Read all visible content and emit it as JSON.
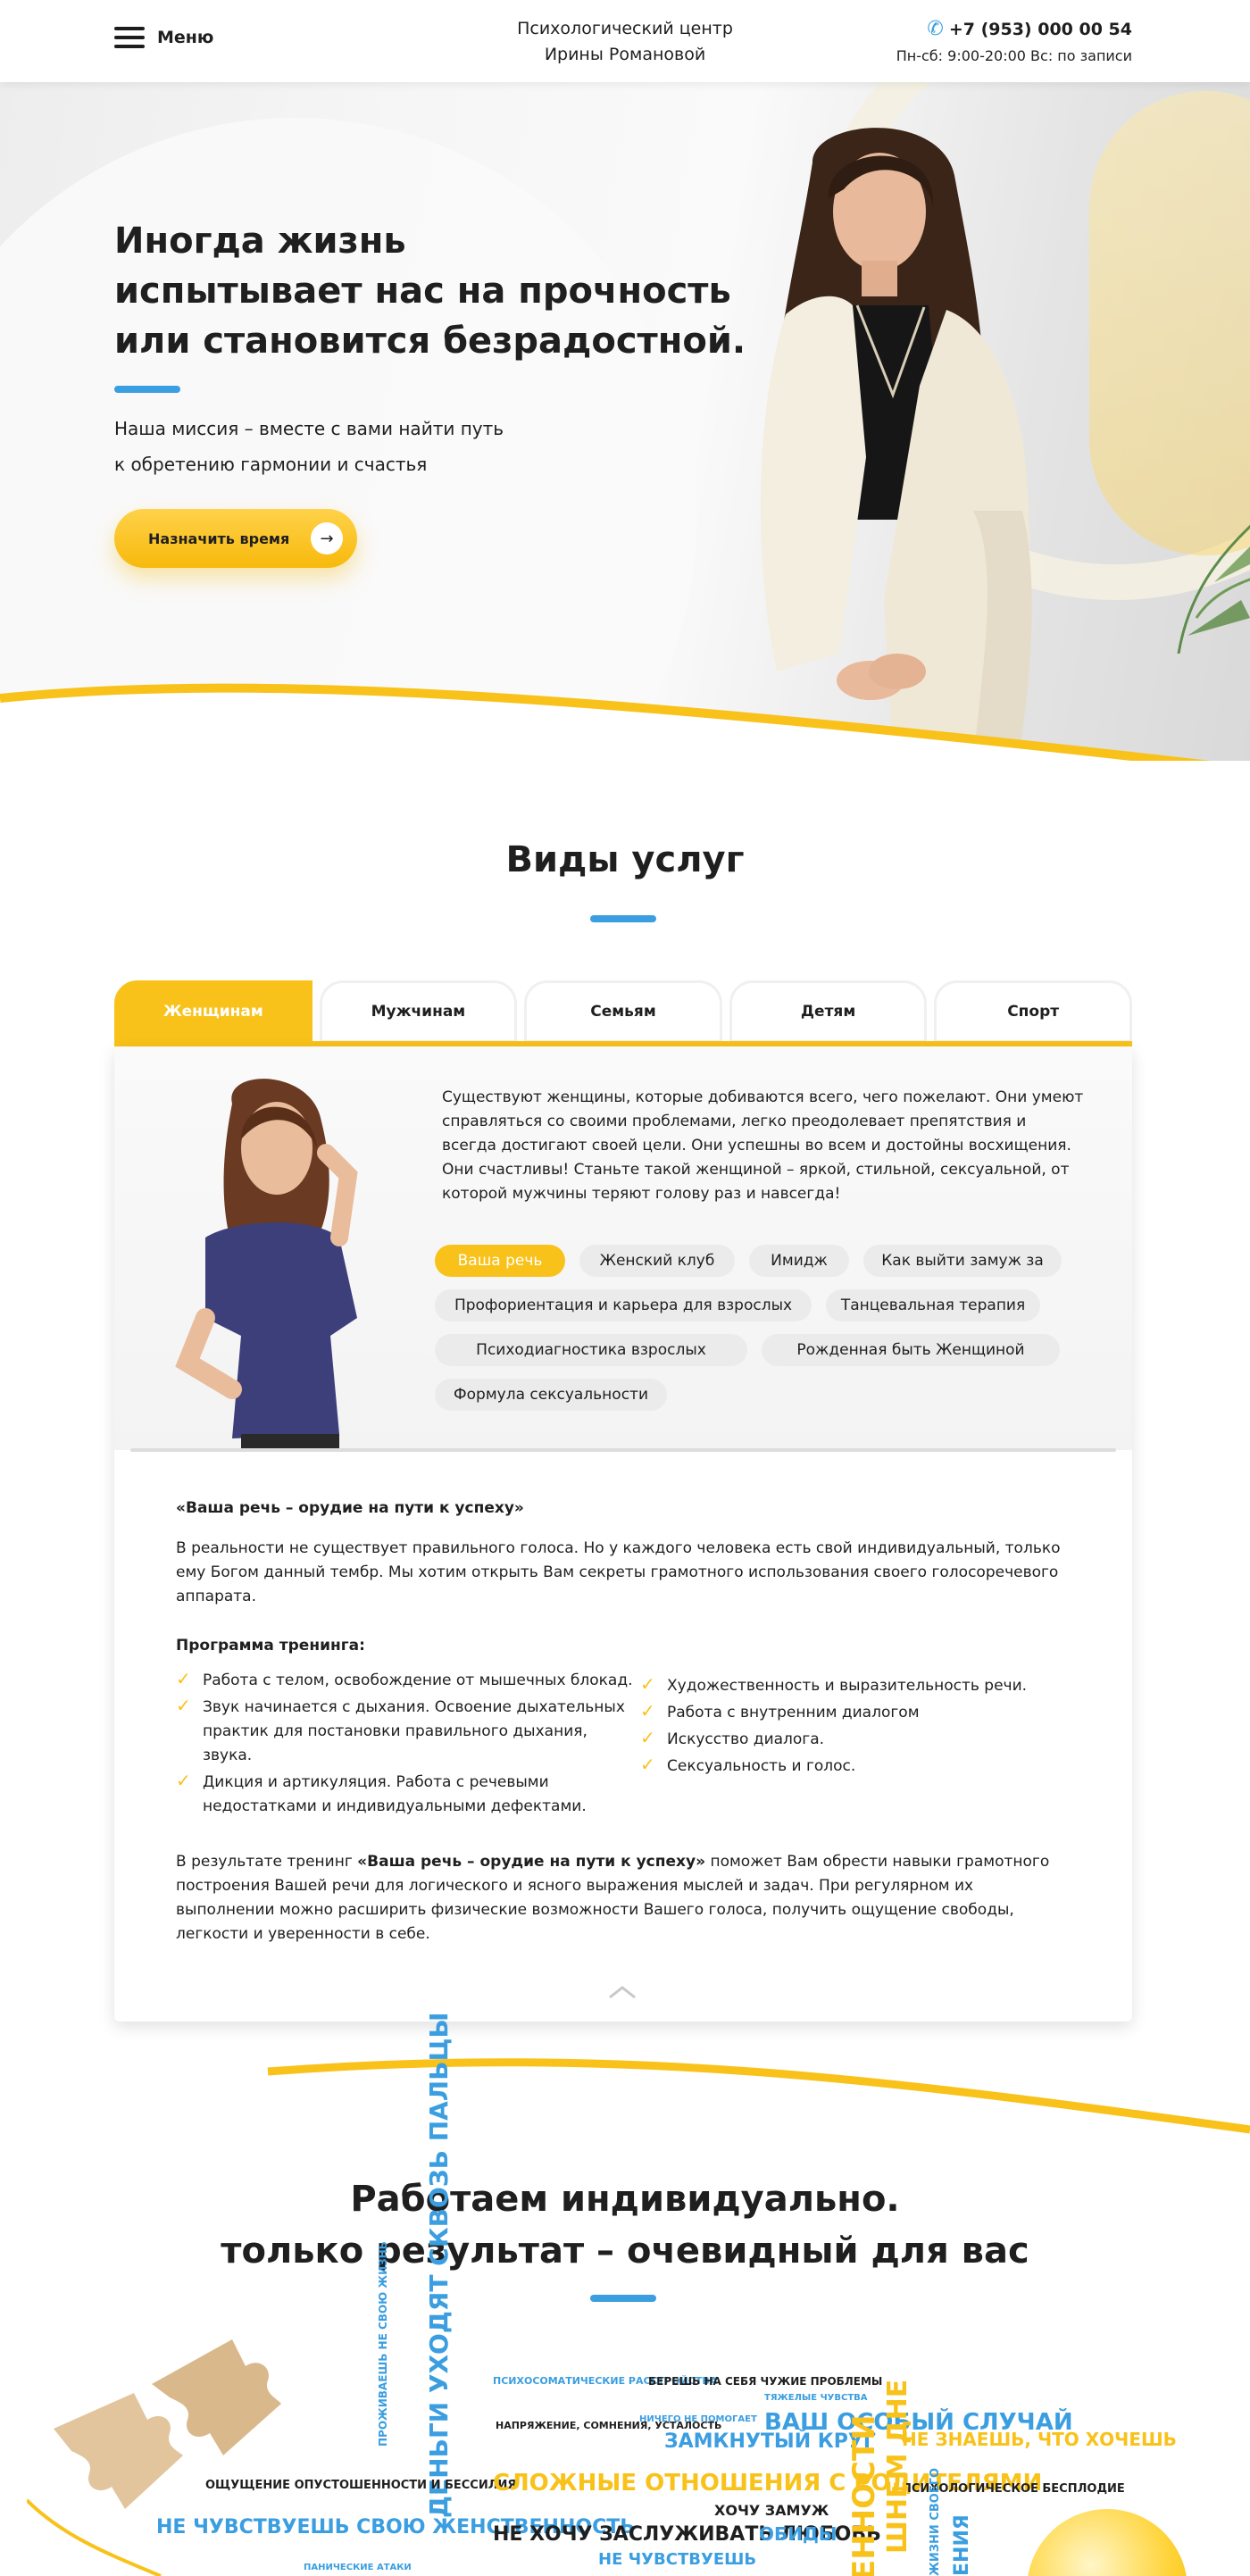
{
  "header": {
    "menu_label": "Меню",
    "brand_line1": "Психологический центр",
    "brand_line2": "Ирины Романовой",
    "phone": "+7 (953) 000 00 54",
    "hours": "Пн-сб: 9:00-20:00 Вс: по записи"
  },
  "hero": {
    "title_line1": "Иногда жизнь",
    "title_line2": "испытывает нас на прочность",
    "title_line3": "или становится безрадостной.",
    "subtitle_line1": "Наша миссия – вместе с вами найти путь",
    "subtitle_line2": "к обретению гармонии и счастья",
    "cta_label": "Назначить время"
  },
  "services": {
    "title": "Виды услуг",
    "tabs": [
      "Женщинам",
      "Мужчинам",
      "Семьям",
      "Детям",
      "Спорт"
    ],
    "active_tab": 0,
    "intro": "Существуют женщины, которые добиваются всего, чего пожелают. Они умеют справляться со своими проблемами, легко преодолевает препятствия и всегда достигают своей цели. Они успешны во всем и достойны восхищения. Они счастливы! Станьте такой женщиной – яркой, стильной, сексуальной, от которой мужчины теряют голову раз и навсегда!",
    "chips": [
      [
        "Ваша речь",
        "Женский клуб",
        "Имидж",
        "Как выйти замуж за"
      ],
      [
        "Профориентация и карьера для взрослых",
        "Танцевальная терапия"
      ],
      [
        "Психодиагностика взрослых",
        "Рожденная быть Женщиной"
      ],
      [
        "Формула сексуальности"
      ]
    ],
    "detail": {
      "heading": "«Ваша речь – орудие на пути к успеху»",
      "paragraph": "В реальности не существует правильного голоса. Но у каждого человека есть свой индивидуальный, только ему Богом данный тембр. Мы хотим открыть Вам секреты грамотного использования своего голосоречевого аппарата.",
      "program_heading": "Программа тренинга:",
      "list_left": [
        "Работа с телом, освобождение от мышечных блокад.",
        "Звук начинается с дыхания. Освоение дыхательных практик для постановки правильного дыхания, звука.",
        "Дикция и артикуляция. Работа с речевыми недостатками и индивидуальными дефектами."
      ],
      "list_right": [
        "Художественность и выразительность речи.",
        "Работа с внутренним диалогом",
        "Искусство диалога.",
        "Сексуальность и голос."
      ],
      "result_prefix": "В результате тренинг ",
      "result_bold": "«Ваша речь – орудие на пути к успеху»",
      "result_suffix": " поможет Вам обрести навыки грамотного построения Вашей речи для логического и ясного выражения мыслей и задач. При регулярном их выполнении можно расширить физические возможности Вашего голоса, получить ощущение свободы, легкости и уверенности в себе."
    }
  },
  "individual": {
    "title_line1": "Работаем индивидуально.",
    "title_line2": "только результат – очевидный для вас",
    "cloud": [
      "ПРОЖИВАЕШЬ НЕ СВОЮ ЖИЗНЬ",
      "ДЕНЬГИ УХОДЯТ СКВОЗЬ ПАЛЬЦЫ",
      "ПСИХОСОМАТИЧЕСКИЕ РАССТРОЙСТВА",
      "БЕРЕШЬ НА СЕБЯ ЧУЖИЕ ПРОБЛЕМЫ",
      "НИЧЕГО НЕ ПОМОГАЕТ",
      "ТЯЖЕЛЫЕ ЧУВСТВА",
      "ВАШ ОСОБЫЙ СЛУЧАЙ",
      "НАПРЯЖЕНИЕ, СОМНЕНИЯ, УСТАЛОСТЬ",
      "ЗАМКНУТЫЙ КРУГ",
      "НЕ ЗНАЕШЬ, ЧТО ХОЧЕШЬ",
      "ОЩУЩЕНИЕ ОПУСТОШЕННОСТИ И БЕССИЛИЯ",
      "СЛОЖНЫЕ ОТНОШЕНИЯ С РОДИТЕЛЯМИ",
      "ХОЧУ ЗАМУЖ",
      "ПСИХОЛОГИЧЕСКОЕ БЕСПЛОДИЕ",
      "НЕ ЧУВСТВУЕШЬ СВОЮ ЖЕНСТВЕННОСТЬ",
      "НЕ ХОЧУ ЗАСЛУЖИВАТЬ ЛЮБОВЬ",
      "ОБИДЫ",
      "НЕ ЧУВСТВУЕШЬ",
      "ПАНИЧЕСКИЕ АТАКИ",
      "ЕННОСТИ",
      "ШНЕМ ДНЕ",
      "ЖИЗНИ СВОЕГО",
      "ЕНИЯ"
    ]
  },
  "colors": {
    "accent_yellow": "#f8c21a",
    "accent_blue": "#3a9ee0",
    "text_dark": "#1f1f1f"
  }
}
